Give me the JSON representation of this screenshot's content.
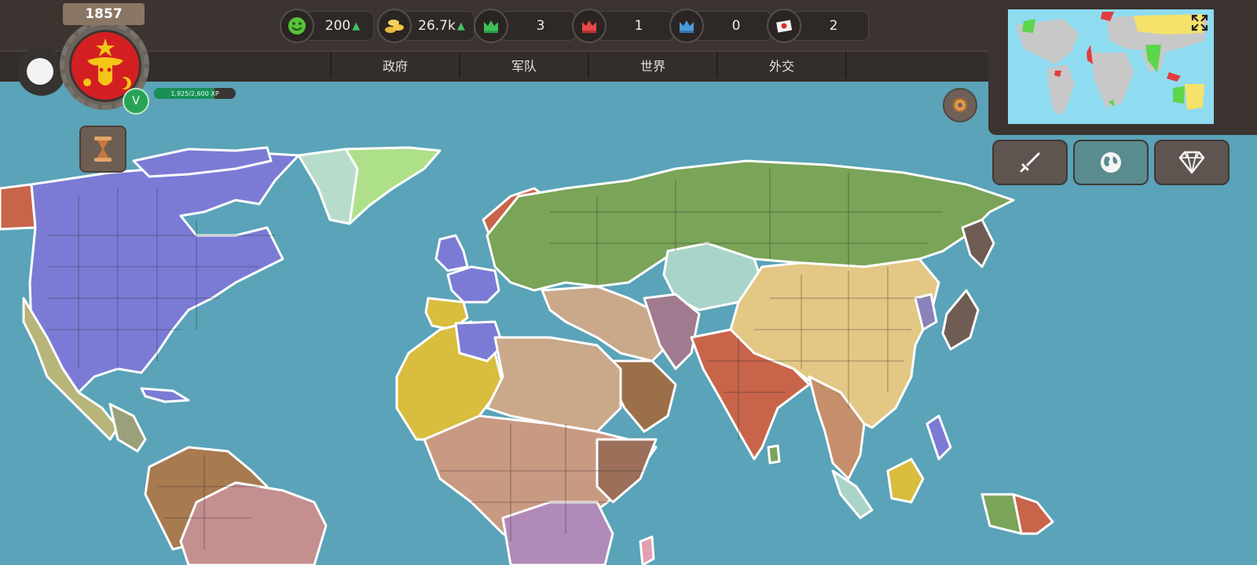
{
  "header": {
    "year": "1857",
    "level": "V",
    "xp_text": "1,925/2,600 XP",
    "xp_fraction": 0.74
  },
  "resources": [
    {
      "name": "stability",
      "icon": "smiley-face-icon",
      "value": "200",
      "trend": "up"
    },
    {
      "name": "money",
      "icon": "gold-coins-icon",
      "value": "26.7k",
      "trend": "up"
    },
    {
      "name": "green-crown",
      "icon": "green-crown-icon",
      "value": "3"
    },
    {
      "name": "red-crown",
      "icon": "red-crown-icon",
      "value": "1"
    },
    {
      "name": "blue-crown",
      "icon": "blue-crown-icon",
      "value": "0"
    },
    {
      "name": "treaty",
      "icon": "treaty-flag-icon",
      "value": "2"
    }
  ],
  "tabs": [
    "政府",
    "军队",
    "世界",
    "外交"
  ],
  "colors": {
    "ocean": "#5aa3b8",
    "topbar": "#3b3431",
    "usa": "#7b7bd6",
    "russia": "#7aa457",
    "china": "#e3c785",
    "india": "#c8644a",
    "africa": "#c99a82",
    "yellow_colony": "#d8bd3e",
    "brown": "#9b6f48",
    "teal_region": "#a9d4c9"
  },
  "right_buttons": [
    {
      "name": "war",
      "icon": "sword-icon"
    },
    {
      "name": "world",
      "icon": "globe-icon"
    },
    {
      "name": "premium",
      "icon": "diamond-icon"
    }
  ]
}
